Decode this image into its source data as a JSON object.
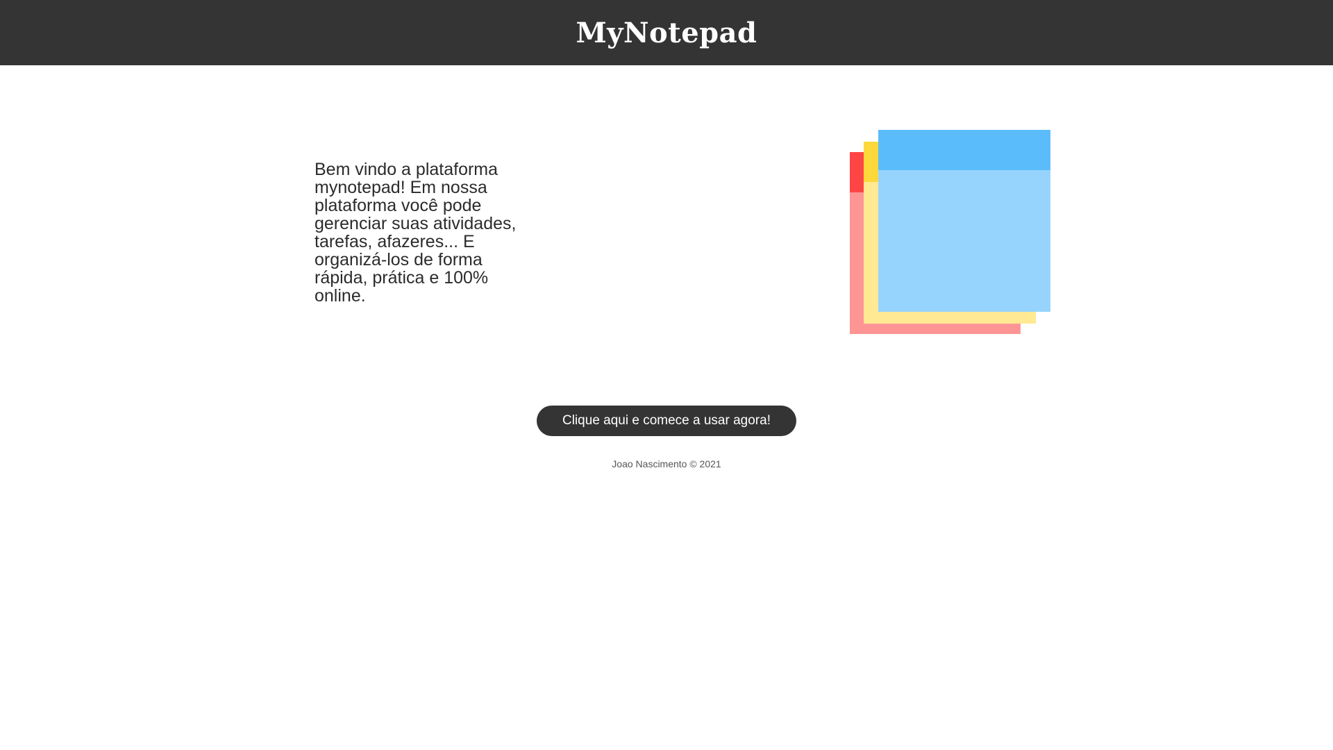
{
  "header": {
    "brand": "MyNotepad",
    "background_color": "#343434"
  },
  "main": {
    "intro_text": "Bem vindo a plataforma mynotepad! Em nossa plataforma você pode gerenciar suas atividades, tarefas, afazeres... E organizá-los de forma rápida, prática e 100% online.",
    "illustration": {
      "icon": "sticky-notes-icon",
      "note_colors": [
        {
          "band": "#fe4545",
          "body": "#fd9595"
        },
        {
          "band": "#fcd83b",
          "body": "#ffe993"
        },
        {
          "band": "#5bbcfc",
          "body": "#96d4fe"
        }
      ]
    },
    "cta_label": "Clique aqui e comece a usar agora!"
  },
  "footer": {
    "text": "Joao Nascimento © 2021"
  }
}
